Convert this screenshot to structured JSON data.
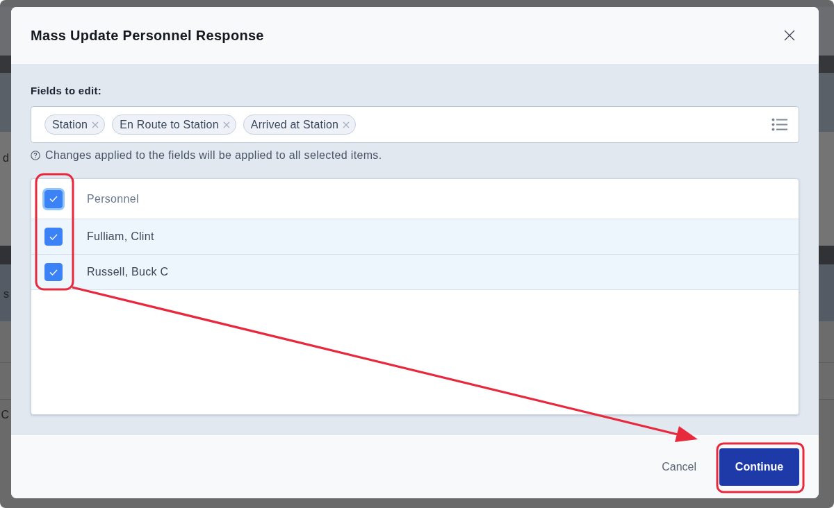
{
  "background_page": {
    "texts": [
      "d",
      "s",
      "C"
    ]
  },
  "dialog": {
    "title": "Mass Update Personnel Response",
    "fields": {
      "label": "Fields to edit:",
      "tags": [
        {
          "label": "Station"
        },
        {
          "label": "En Route to Station"
        },
        {
          "label": "Arrived at Station"
        }
      ]
    },
    "help_text": "Changes applied to the fields will be applied to all selected items.",
    "table": {
      "header": {
        "label": "Personnel",
        "checked": true,
        "focused": true
      },
      "rows": [
        {
          "name": "Fulliam, Clint",
          "selected": true
        },
        {
          "name": "Russell, Buck C",
          "selected": true
        }
      ]
    },
    "buttons": [
      {
        "label": "Cancel",
        "kind": "text"
      },
      {
        "label": "Continue",
        "kind": "primary"
      }
    ]
  }
}
